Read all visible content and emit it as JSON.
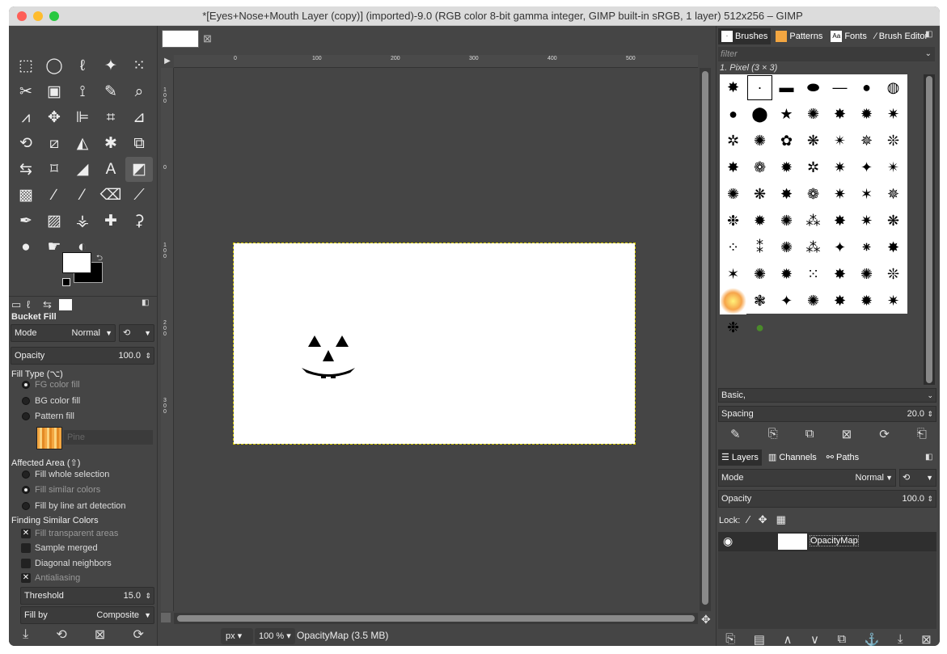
{
  "window": {
    "title": "*[Eyes+Nose+Mouth Layer (copy)] (imported)-9.0 (RGB color 8-bit gamma integer, GIMP built-in sRGB, 1 layer) 512x256 – GIMP"
  },
  "toolbox": {
    "tools": [
      {
        "name": "rect-select-icon",
        "glyph": "⬚"
      },
      {
        "name": "ellipse-select-icon",
        "glyph": "◯"
      },
      {
        "name": "free-select-icon",
        "glyph": "ℓ"
      },
      {
        "name": "fuzzy-select-icon",
        "glyph": "✦"
      },
      {
        "name": "select-by-color-icon",
        "glyph": "⁙"
      },
      {
        "name": "scissors-select-icon",
        "glyph": "✂"
      },
      {
        "name": "foreground-select-icon",
        "glyph": "▣"
      },
      {
        "name": "paths-icon",
        "glyph": "⟟"
      },
      {
        "name": "color-picker-icon",
        "glyph": "✎"
      },
      {
        "name": "zoom-icon",
        "glyph": "⌕"
      },
      {
        "name": "measure-icon",
        "glyph": "⩘"
      },
      {
        "name": "move-icon",
        "glyph": "✥"
      },
      {
        "name": "align-icon",
        "glyph": "⊫"
      },
      {
        "name": "crop-icon",
        "glyph": "⌗"
      },
      {
        "name": "unified-transform-icon",
        "glyph": "⊿"
      },
      {
        "name": "rotate-icon",
        "glyph": "⟲"
      },
      {
        "name": "shear-icon",
        "glyph": "⧄"
      },
      {
        "name": "perspective-icon",
        "glyph": "◭"
      },
      {
        "name": "warp-transform-icon",
        "glyph": "✱"
      },
      {
        "name": "3d-transform-icon",
        "glyph": "⧉"
      },
      {
        "name": "flip-icon",
        "glyph": "⇆"
      },
      {
        "name": "cage-transform-icon",
        "glyph": "⌑"
      },
      {
        "name": "smudge-warp-icon",
        "glyph": "◢"
      },
      {
        "name": "text-icon",
        "glyph": "A"
      },
      {
        "name": "bucket-fill-icon",
        "glyph": "◩"
      },
      {
        "name": "gradient-icon",
        "glyph": "▩"
      },
      {
        "name": "pencil-icon",
        "glyph": "∕"
      },
      {
        "name": "paintbrush-icon",
        "glyph": "⁄"
      },
      {
        "name": "eraser-icon",
        "glyph": "⌫"
      },
      {
        "name": "airbrush-icon",
        "glyph": "⟋"
      },
      {
        "name": "ink-icon",
        "glyph": "✒"
      },
      {
        "name": "mypaint-brush-icon",
        "glyph": "▨"
      },
      {
        "name": "clone-icon",
        "glyph": "⚶"
      },
      {
        "name": "heal-icon",
        "glyph": "✚"
      },
      {
        "name": "perspective-clone-icon",
        "glyph": "⚳"
      },
      {
        "name": "blur-icon",
        "glyph": "●"
      },
      {
        "name": "smudge-icon",
        "glyph": "☛"
      },
      {
        "name": "dodge-burn-icon",
        "glyph": "◐"
      }
    ],
    "selected_index": 24
  },
  "tool_options": {
    "title": "Bucket Fill",
    "mode_label": "Mode",
    "mode_value": "Normal",
    "opacity_label": "Opacity",
    "opacity_value": "100.0",
    "fill_type_label": "Fill Type  (⌥)",
    "fg_fill": "FG color fill",
    "bg_fill": "BG color fill",
    "pattern_fill": "Pattern fill",
    "pattern_name": "Pine",
    "affected_area_label": "Affected Area  (⇧)",
    "fill_whole": "Fill whole selection",
    "fill_similar": "Fill similar colors",
    "fill_lineart": "Fill by line art detection",
    "finding_label": "Finding Similar Colors",
    "fill_transparent": "Fill transparent areas",
    "sample_merged": "Sample merged",
    "diagonal": "Diagonal neighbors",
    "antialiasing": "Antialiasing",
    "threshold_label": "Threshold",
    "threshold_value": "15.0",
    "fillby_label": "Fill by",
    "fillby_value": "Composite"
  },
  "ruler": {
    "h_ticks": [
      "0",
      "100",
      "200",
      "300",
      "400",
      "500"
    ],
    "v_ticks": [
      "1 0 0",
      "0",
      "1 0 0",
      "2 0 0",
      "3 0 0"
    ]
  },
  "status": {
    "unit": "px",
    "zoom": "100 %",
    "text": "OpacityMap (3.5 MB)"
  },
  "brushes": {
    "tabs": [
      "Brushes",
      "Patterns",
      "Fonts",
      "Brush Editor"
    ],
    "filter_placeholder": "filter",
    "current_brush": "1. Pixel (3 × 3)",
    "preset": "Basic,",
    "spacing_label": "Spacing",
    "spacing_value": "20.0"
  },
  "layers": {
    "tabs": [
      "Layers",
      "Channels",
      "Paths"
    ],
    "mode_label": "Mode",
    "mode_value": "Normal",
    "opacity_label": "Opacity",
    "opacity_value": "100.0",
    "lock_label": "Lock:",
    "layer_name": "OpacityMap"
  }
}
